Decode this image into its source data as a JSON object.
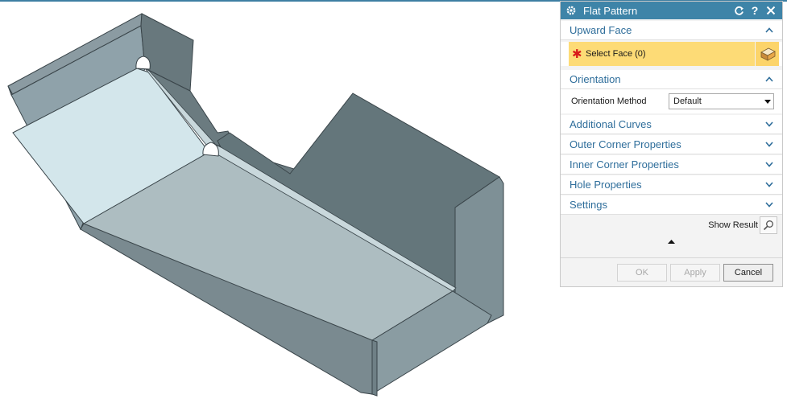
{
  "dialog": {
    "title": "Flat Pattern",
    "title_icon": "gear-icon",
    "controls": [
      "reset-icon",
      "help-icon",
      "close-icon"
    ]
  },
  "upward_face": {
    "header": "Upward Face",
    "expanded": true,
    "select_face_label": "Select Face (0)",
    "required_marker": "✱"
  },
  "orientation": {
    "header": "Orientation",
    "expanded": true,
    "method_label": "Orientation Method",
    "method_value": "Default"
  },
  "collapsed_groups": [
    {
      "label": "Additional Curves"
    },
    {
      "label": "Outer Corner Properties"
    },
    {
      "label": "Inner Corner Properties"
    },
    {
      "label": "Hole Properties"
    },
    {
      "label": "Settings"
    }
  ],
  "show_result_label": "Show Result",
  "buttons": {
    "ok": "OK",
    "apply": "Apply",
    "cancel": "Cancel"
  },
  "colors": {
    "titlebar": "#3e84a8",
    "header_text": "#2f6e9b",
    "selection_highlight": "#fddb76",
    "required_star": "#d81818"
  }
}
